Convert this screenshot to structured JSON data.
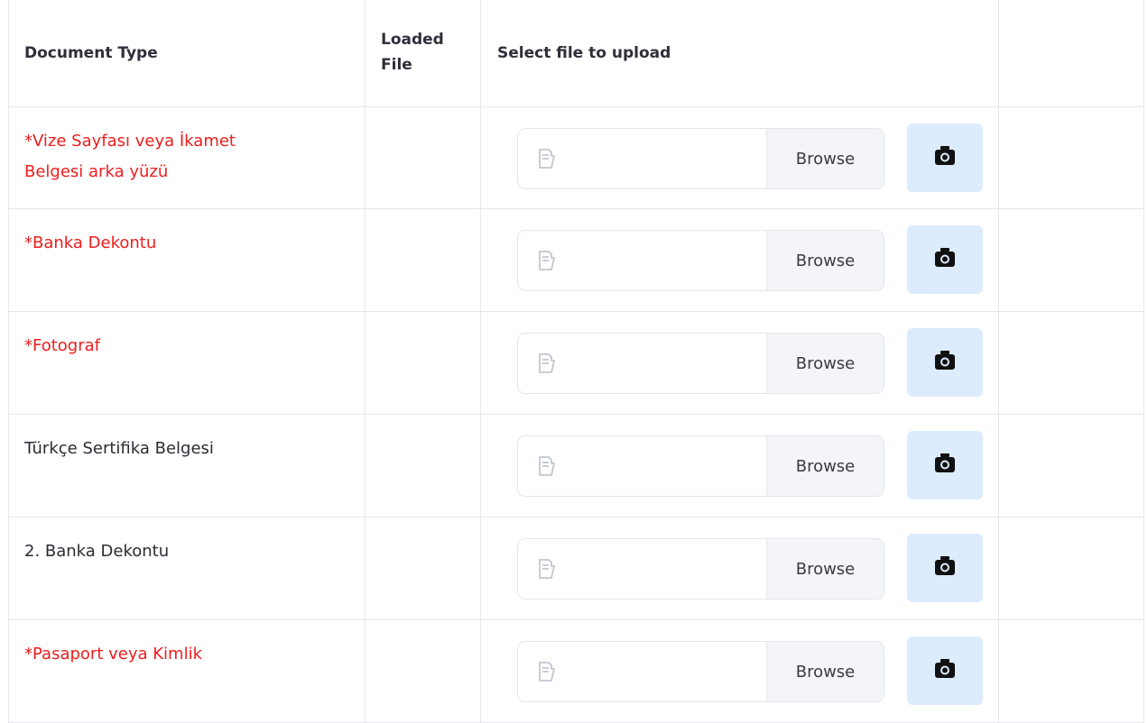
{
  "table": {
    "headers": {
      "document_type": "Document Type",
      "loaded_file_line1": "Loaded",
      "loaded_file_line2": "File",
      "select_file": "Select file to upload",
      "actions": ""
    },
    "rows": [
      {
        "doc_line1": "*Vize Sayfası veya İkamet",
        "doc_line2": "Belgesi arka yüzü",
        "required": true,
        "loaded_file": "",
        "file_value": "",
        "browse_label": "Browse"
      },
      {
        "doc_line1": "*Banka Dekontu",
        "doc_line2": "",
        "required": true,
        "loaded_file": "",
        "file_value": "",
        "browse_label": "Browse"
      },
      {
        "doc_line1": "*Fotograf",
        "doc_line2": "",
        "required": true,
        "loaded_file": "",
        "file_value": "",
        "browse_label": "Browse"
      },
      {
        "doc_line1": "Türkçe Sertifika Belgesi",
        "doc_line2": "",
        "required": false,
        "loaded_file": "",
        "file_value": "",
        "browse_label": "Browse"
      },
      {
        "doc_line1": "2. Banka Dekontu",
        "doc_line2": "",
        "required": false,
        "loaded_file": "",
        "file_value": "",
        "browse_label": "Browse"
      },
      {
        "doc_line1": "*Pasaport veya Kimlik",
        "doc_line2": "",
        "required": true,
        "loaded_file": "",
        "file_value": "",
        "browse_label": "Browse"
      }
    ]
  },
  "icons": {
    "file": "file-icon",
    "camera": "camera-icon"
  },
  "colors": {
    "required_text": "#ee1c1c",
    "camera_button_bg": "#dcecfc",
    "browse_bg": "#f3f5f8",
    "border": "#e6e7ec"
  }
}
